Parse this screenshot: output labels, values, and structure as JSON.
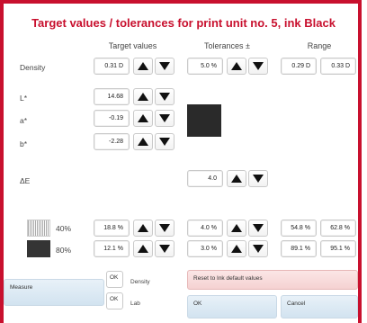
{
  "dialog": {
    "title": "Target values / tolerances for print unit no. 5, ink Black"
  },
  "columns": {
    "target": "Target values",
    "tolerances": "Tolerances ±",
    "range": "Range"
  },
  "rows": {
    "density": {
      "label": "Density",
      "target": "0.31 D",
      "tolerance": "5.0 %",
      "range_min": "0.29 D",
      "range_max": "0.33 D"
    },
    "l_star": {
      "label": "L*",
      "target": "14.68"
    },
    "a_star": {
      "label": "a*",
      "target": "-0.19"
    },
    "b_star": {
      "label": "b*",
      "target": "-2.28"
    },
    "delta_e": {
      "label": "ΔE",
      "tolerance": "4.0"
    },
    "tv40": {
      "label": "40%",
      "target": "18.8 %",
      "tolerance": "4.0 %",
      "range_min": "54.8 %",
      "range_max": "62.8 %"
    },
    "tv80": {
      "label": "80%",
      "target": "12.1 %",
      "tolerance": "3.0 %",
      "range_min": "89.1 %",
      "range_max": "95.1 %"
    }
  },
  "buttons": {
    "measure": "Measure",
    "ok_density": "OK",
    "density_label": "Density",
    "ok_lab": "OK",
    "lab_label": "Lab",
    "reset": "Reset to  Ink default values",
    "ok": "OK",
    "cancel": "Cancel"
  },
  "colors": {
    "accent": "#c8102e",
    "swatch": "#2a2a2a"
  },
  "icons": {
    "up": "up-arrow-icon",
    "down": "down-arrow-icon"
  }
}
